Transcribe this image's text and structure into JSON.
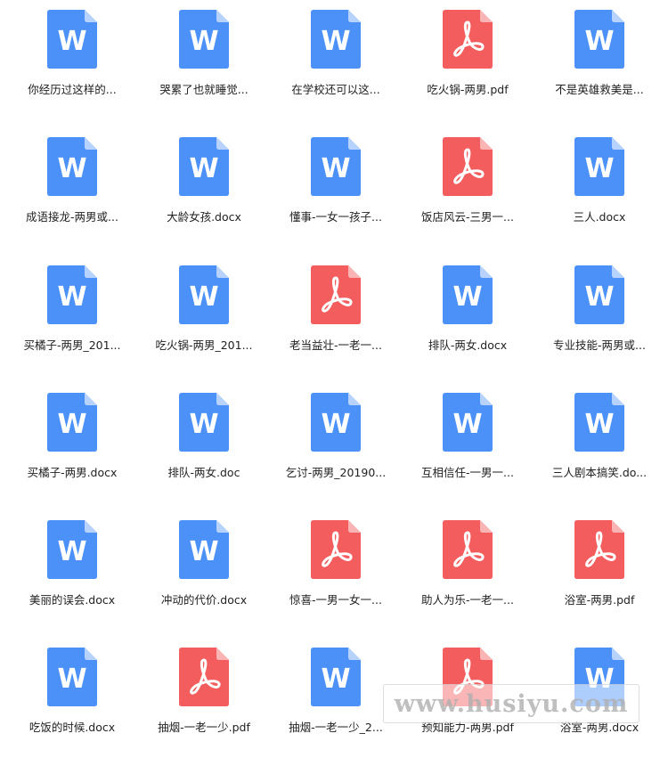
{
  "colors": {
    "word_icon": "#4b91f8",
    "word_fold": "#b6d2fd",
    "pdf_icon": "#f45d5d",
    "pdf_fold": "#fbb4b4",
    "label_text": "#222222"
  },
  "icons": {
    "word_letter": "W",
    "word_name": "word-document-icon",
    "pdf_name": "pdf-document-icon"
  },
  "files": [
    {
      "name": "你经历过这样的...",
      "type": "word"
    },
    {
      "name": "哭累了也就睡觉...",
      "type": "word"
    },
    {
      "name": "在学校还可以这...",
      "type": "word"
    },
    {
      "name": "吃火锅-两男.pdf",
      "type": "pdf"
    },
    {
      "name": "不是英雄救美是...",
      "type": "word"
    },
    {
      "name": "成语接龙-两男或...",
      "type": "word"
    },
    {
      "name": "大龄女孩.docx",
      "type": "word"
    },
    {
      "name": "懂事-一女一孩子...",
      "type": "word"
    },
    {
      "name": "饭店风云-三男一...",
      "type": "pdf"
    },
    {
      "name": "三人.docx",
      "type": "word"
    },
    {
      "name": "买橘子-两男_201...",
      "type": "word"
    },
    {
      "name": "吃火锅-两男_201...",
      "type": "word"
    },
    {
      "name": "老当益壮-一老一...",
      "type": "pdf"
    },
    {
      "name": "排队-两女.docx",
      "type": "word"
    },
    {
      "name": "专业技能-两男或...",
      "type": "word"
    },
    {
      "name": "买橘子-两男.docx",
      "type": "word"
    },
    {
      "name": "排队-两女.doc",
      "type": "word"
    },
    {
      "name": "乞讨-两男_20190...",
      "type": "word"
    },
    {
      "name": "互相信任-一男一...",
      "type": "word"
    },
    {
      "name": "三人剧本搞笑.do...",
      "type": "word"
    },
    {
      "name": "美丽的误会.docx",
      "type": "word"
    },
    {
      "name": "冲动的代价.docx",
      "type": "word"
    },
    {
      "name": "惊喜-一男一女一...",
      "type": "pdf"
    },
    {
      "name": "助人为乐-一老一...",
      "type": "pdf"
    },
    {
      "name": "浴室-两男.pdf",
      "type": "pdf"
    },
    {
      "name": "吃饭的时候.docx",
      "type": "word"
    },
    {
      "name": "抽烟-一老一少.pdf",
      "type": "pdf"
    },
    {
      "name": "抽烟-一老一少_2...",
      "type": "word"
    },
    {
      "name": "预知能力-两男.pdf",
      "type": "pdf"
    },
    {
      "name": "浴室-两男.docx",
      "type": "word"
    }
  ],
  "watermark": {
    "text": "www.husiyu.com"
  }
}
